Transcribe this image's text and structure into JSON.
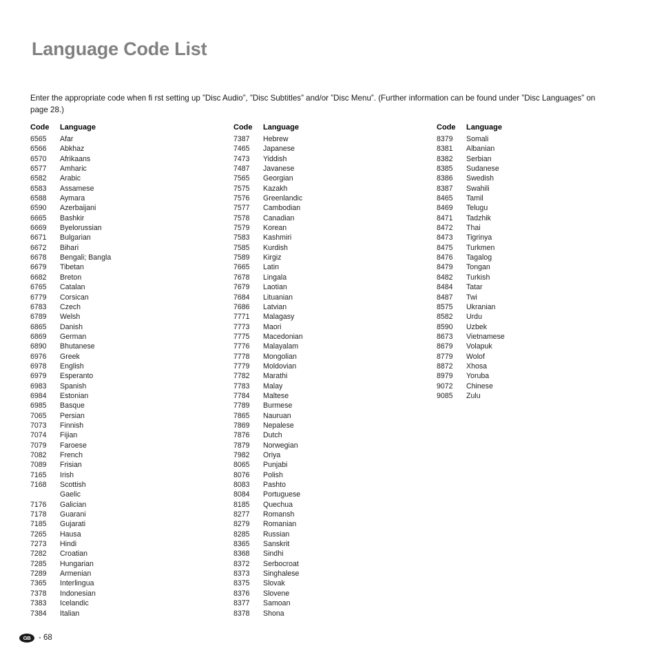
{
  "document": {
    "title": "Language Code List",
    "intro": "Enter the appropriate code when fi rst setting up ”Disc Audio”, ”Disc Subtitles” and/or ”Disc Menu”. (Further information can be found under ”Disc Languages” on page 28.)",
    "title_color": "#808080",
    "text_color": "#1a1a1a"
  },
  "footer": {
    "region_code": "GB",
    "page_label": "- 68"
  },
  "table": {
    "headers": {
      "code": "Code",
      "language": "Language"
    },
    "columns": [
      {
        "headers": {
          "code": "Code",
          "language": "Language"
        },
        "rows": [
          {
            "code": "6565",
            "language": "Afar"
          },
          {
            "code": "6566",
            "language": "Abkhaz"
          },
          {
            "code": "6570",
            "language": "Afrikaans"
          },
          {
            "code": "6577",
            "language": "Amharic"
          },
          {
            "code": "6582",
            "language": "Arabic"
          },
          {
            "code": "6583",
            "language": "Assamese"
          },
          {
            "code": "6588",
            "language": "Aymara"
          },
          {
            "code": "6590",
            "language": "Azerbaijani"
          },
          {
            "code": "6665",
            "language": "Bashkir"
          },
          {
            "code": "6669",
            "language": "Byelorussian"
          },
          {
            "code": "6671",
            "language": "Bulgarian"
          },
          {
            "code": "6672",
            "language": "Bihari"
          },
          {
            "code": "6678",
            "language": "Bengali; Bangla"
          },
          {
            "code": "6679",
            "language": "Tibetan"
          },
          {
            "code": "6682",
            "language": "Breton"
          },
          {
            "code": "6765",
            "language": "Catalan"
          },
          {
            "code": "6779",
            "language": "Corsican"
          },
          {
            "code": "6783",
            "language": "Czech"
          },
          {
            "code": "6789",
            "language": "Welsh"
          },
          {
            "code": "6865",
            "language": "Danish"
          },
          {
            "code": "6869",
            "language": "German"
          },
          {
            "code": "6890",
            "language": "Bhutanese"
          },
          {
            "code": "6976",
            "language": "Greek"
          },
          {
            "code": "6978",
            "language": "English"
          },
          {
            "code": "6979",
            "language": "Esperanto"
          },
          {
            "code": "6983",
            "language": "Spanish"
          },
          {
            "code": "6984",
            "language": "Estonian"
          },
          {
            "code": "6985",
            "language": "Basque"
          },
          {
            "code": "7065",
            "language": "Persian"
          },
          {
            "code": "7073",
            "language": "Finnish"
          },
          {
            "code": "7074",
            "language": "Fijian"
          },
          {
            "code": "7079",
            "language": "Faroese"
          },
          {
            "code": "7082",
            "language": "French"
          },
          {
            "code": "7089",
            "language": "Frisian"
          },
          {
            "code": "7165",
            "language": "Irish"
          },
          {
            "code": "7168",
            "language": "Scottish"
          },
          {
            "code": "",
            "language": "Gaelic"
          },
          {
            "code": "7176",
            "language": "Galician"
          },
          {
            "code": "7178",
            "language": "Guarani"
          },
          {
            "code": "7185",
            "language": "Gujarati"
          },
          {
            "code": "7265",
            "language": "Hausa"
          },
          {
            "code": "7273",
            "language": "Hindi"
          },
          {
            "code": "7282",
            "language": "Croatian"
          },
          {
            "code": "7285",
            "language": "Hungarian"
          },
          {
            "code": "7289",
            "language": "Armenian"
          },
          {
            "code": "7365",
            "language": "Interlingua"
          },
          {
            "code": "7378",
            "language": "Indonesian"
          },
          {
            "code": "7383",
            "language": "Icelandic"
          },
          {
            "code": "7384",
            "language": "Italian"
          }
        ]
      },
      {
        "headers": {
          "code": "Code",
          "language": "Language"
        },
        "rows": [
          {
            "code": "7387",
            "language": "Hebrew"
          },
          {
            "code": "7465",
            "language": "Japanese"
          },
          {
            "code": "7473",
            "language": "Yiddish"
          },
          {
            "code": "7487",
            "language": "Javanese"
          },
          {
            "code": "7565",
            "language": "Georgian"
          },
          {
            "code": "7575",
            "language": "Kazakh"
          },
          {
            "code": "7576",
            "language": "Greenlandic"
          },
          {
            "code": "7577",
            "language": "Cambodian"
          },
          {
            "code": "7578",
            "language": "Canadian"
          },
          {
            "code": "7579",
            "language": "Korean"
          },
          {
            "code": "7583",
            "language": "Kashmiri"
          },
          {
            "code": "7585",
            "language": "Kurdish"
          },
          {
            "code": "7589",
            "language": "Kirgiz"
          },
          {
            "code": "7665",
            "language": "Latin"
          },
          {
            "code": "7678",
            "language": "Lingala"
          },
          {
            "code": "7679",
            "language": "Laotian"
          },
          {
            "code": "7684",
            "language": "Lituanian"
          },
          {
            "code": "7686",
            "language": "Latvian"
          },
          {
            "code": "7771",
            "language": "Malagasy"
          },
          {
            "code": "7773",
            "language": "Maori"
          },
          {
            "code": "7775",
            "language": "Macedonian"
          },
          {
            "code": "7776",
            "language": "Malayalam"
          },
          {
            "code": "7778",
            "language": "Mongolian"
          },
          {
            "code": "7779",
            "language": "Moldovian"
          },
          {
            "code": "7782",
            "language": "Marathi"
          },
          {
            "code": "7783",
            "language": "Malay"
          },
          {
            "code": "7784",
            "language": "Maltese"
          },
          {
            "code": "7789",
            "language": "Burmese"
          },
          {
            "code": "7865",
            "language": "Nauruan"
          },
          {
            "code": "7869",
            "language": "Nepalese"
          },
          {
            "code": "7876",
            "language": "Dutch"
          },
          {
            "code": "7879",
            "language": "Norwegian"
          },
          {
            "code": "7982",
            "language": "Oriya"
          },
          {
            "code": "8065",
            "language": "Punjabi"
          },
          {
            "code": "8076",
            "language": "Polish"
          },
          {
            "code": "8083",
            "language": "Pashto"
          },
          {
            "code": "8084",
            "language": "Portuguese"
          },
          {
            "code": "8185",
            "language": "Quechua"
          },
          {
            "code": "8277",
            "language": "Romansh"
          },
          {
            "code": "8279",
            "language": "Romanian"
          },
          {
            "code": "8285",
            "language": "Russian"
          },
          {
            "code": "8365",
            "language": "Sanskrit"
          },
          {
            "code": "8368",
            "language": "Sindhi"
          },
          {
            "code": "8372",
            "language": "Serbocroat"
          },
          {
            "code": "8373",
            "language": "Singhalese"
          },
          {
            "code": "8375",
            "language": "Slovak"
          },
          {
            "code": "8376",
            "language": "Slovene"
          },
          {
            "code": "8377",
            "language": "Samoan"
          },
          {
            "code": "8378",
            "language": "Shona"
          }
        ]
      },
      {
        "headers": {
          "code": "Code",
          "language": "Language"
        },
        "rows": [
          {
            "code": "8379",
            "language": "Somali"
          },
          {
            "code": "8381",
            "language": "Albanian"
          },
          {
            "code": "8382",
            "language": "Serbian"
          },
          {
            "code": "8385",
            "language": "Sudanese"
          },
          {
            "code": "8386",
            "language": "Swedish"
          },
          {
            "code": "8387",
            "language": "Swahili"
          },
          {
            "code": "8465",
            "language": "Tamil"
          },
          {
            "code": "8469",
            "language": "Telugu"
          },
          {
            "code": "8471",
            "language": "Tadzhik"
          },
          {
            "code": "8472",
            "language": "Thai"
          },
          {
            "code": "8473",
            "language": "Tigrinya"
          },
          {
            "code": "8475",
            "language": "Turkmen"
          },
          {
            "code": "8476",
            "language": "Tagalog"
          },
          {
            "code": "8479",
            "language": "Tongan"
          },
          {
            "code": "8482",
            "language": "Turkish"
          },
          {
            "code": "8484",
            "language": "Tatar"
          },
          {
            "code": "8487",
            "language": "Twi"
          },
          {
            "code": "8575",
            "language": "Ukranian"
          },
          {
            "code": "8582",
            "language": "Urdu"
          },
          {
            "code": "8590",
            "language": "Uzbek"
          },
          {
            "code": "8673",
            "language": "Vietnamese"
          },
          {
            "code": "8679",
            "language": "Volapuk"
          },
          {
            "code": "8779",
            "language": "Wolof"
          },
          {
            "code": "8872",
            "language": "Xhosa"
          },
          {
            "code": "8979",
            "language": "Yoruba"
          },
          {
            "code": "9072",
            "language": "Chinese"
          },
          {
            "code": "9085",
            "language": "Zulu"
          }
        ]
      }
    ]
  }
}
